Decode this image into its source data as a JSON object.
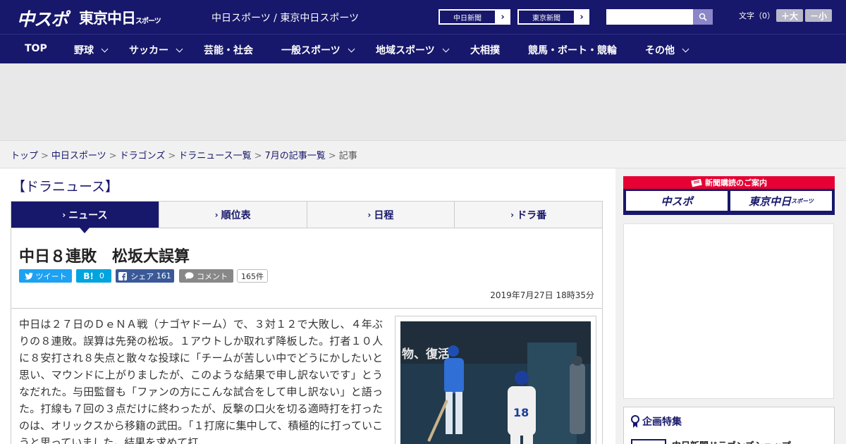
{
  "header": {
    "logo_main": "中スポ",
    "logo_tokyo": "東京中日",
    "logo_tokyo_small": "スポーツ",
    "site_name": "中日スポーツ / 東京中日スポーツ",
    "links": [
      {
        "label": "中日新聞",
        "arrow": "›"
      },
      {
        "label": "東京新聞",
        "arrow": "›"
      }
    ],
    "search_placeholder": "",
    "font_size_label": "文字（0）",
    "font_larger": "＋大",
    "font_smaller": "－小"
  },
  "nav": {
    "items": [
      {
        "label": "TOP",
        "dropdown": false
      },
      {
        "label": "野球",
        "dropdown": true
      },
      {
        "label": "サッカー",
        "dropdown": true
      },
      {
        "label": "芸能・社会",
        "dropdown": false
      },
      {
        "label": "一般スポーツ",
        "dropdown": true
      },
      {
        "label": "地域スポーツ",
        "dropdown": true
      },
      {
        "label": "大相撲",
        "dropdown": false
      },
      {
        "label": "競馬・ボート・競輪",
        "dropdown": false
      },
      {
        "label": "その他",
        "dropdown": true
      }
    ]
  },
  "breadcrumb": {
    "items": [
      "トップ",
      "中日スポーツ",
      "ドラゴンズ",
      "ドラニュース一覧",
      "7月の記事一覧"
    ],
    "current": "記事",
    "separator": ">"
  },
  "section_title": "【ドラニュース】",
  "tabs": [
    {
      "label": "ニュース",
      "active": true
    },
    {
      "label": "順位表",
      "active": false
    },
    {
      "label": "日程",
      "active": false
    },
    {
      "label": "ドラ番",
      "active": false
    }
  ],
  "article": {
    "headline": "中日８連敗　松坂大誤算",
    "share": {
      "tweet": "ツイート",
      "hatena": "0",
      "facebook": "シェア",
      "facebook_count": "161",
      "comment": "コメント",
      "comment_count": "165件"
    },
    "date": "2019年7月27日 18時35分",
    "body": "中日は２７日のＤｅＮＡ戦（ナゴヤドーム）で、３対１２で大敗し、４年ぶりの８連敗。誤算は先発の松坂。１アウトしか取れず降板した。打者１０人に８安打され８失点と散々な投球に「チームが苦しい中でどうにかしたいと思い、マウンドに上がりましたが、このような結果で申し訳ないです」とうなだれた。与田監督も「ファンの方にこんな試合をして申し訳ない」と語った。打線も７回の３点だけに終わったが、反撃の口火を切る適時打を打ったのは、オリックスから移籍の武田。「１打席に集中して、積極的に打っていこうと思っていました。結果を求めて打"
  },
  "sidebar": {
    "banner_title": "新聞購読のご案内",
    "banner_left": "中スポ",
    "banner_right": "東京中日",
    "banner_right_small": "スポーツ",
    "feature_title": "企画特集",
    "feature_item": "中日新聞ドラゴンズショップ"
  },
  "colors": {
    "brand": "#17176b",
    "accent_red": "#e60033",
    "twitter": "#1da1f2",
    "hatena": "#00a4de",
    "facebook": "#3b5998",
    "comment": "#888888"
  }
}
